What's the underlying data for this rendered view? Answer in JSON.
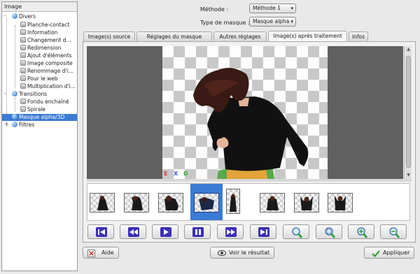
{
  "tree": {
    "header": "Image",
    "items": [
      {
        "label": "Divers",
        "kind": "node"
      },
      {
        "label": "Planche-contact",
        "kind": "leaf"
      },
      {
        "label": "Information",
        "kind": "leaf"
      },
      {
        "label": "Changement d...",
        "kind": "leaf"
      },
      {
        "label": "Redimension",
        "kind": "leaf"
      },
      {
        "label": "Ajout d'éléments",
        "kind": "leaf"
      },
      {
        "label": "Image composite",
        "kind": "leaf"
      },
      {
        "label": "Renommage d'i...",
        "kind": "leaf"
      },
      {
        "label": "Pour le web",
        "kind": "leaf"
      },
      {
        "label": "Multiplication d'i...",
        "kind": "leaf"
      },
      {
        "label": "Transitions",
        "kind": "node"
      },
      {
        "label": "Fondu enchaîné",
        "kind": "leaf"
      },
      {
        "label": "Spirale",
        "kind": "leaf"
      },
      {
        "label": "Masque alpha/3D",
        "kind": "node",
        "selected": true
      },
      {
        "label": "Filtres",
        "kind": "node"
      }
    ]
  },
  "settings": {
    "method_label": "Méthode :",
    "method_value": "Méthode 1",
    "mask_label": "Type de masque :",
    "mask_value": "Masque alpha"
  },
  "tabs": [
    {
      "label": "Image(s) source"
    },
    {
      "label": "Réglages du masque"
    },
    {
      "label": "Autres réglages"
    },
    {
      "label": "Image(s) après traitement",
      "active": true
    },
    {
      "label": "Infos"
    }
  ],
  "preview": {
    "channel_letters": [
      "E",
      "X",
      "D"
    ],
    "channel_colors": [
      "#d23c3c",
      "#3c58d2",
      "#3cae3c"
    ]
  },
  "thumbnails": {
    "count": 8,
    "selected_index": 3
  },
  "playback": [
    {
      "icon": "first-frame-icon"
    },
    {
      "icon": "rewind-icon"
    },
    {
      "icon": "play-icon"
    },
    {
      "icon": "pause-icon"
    },
    {
      "icon": "fast-forward-icon"
    },
    {
      "icon": "last-frame-icon"
    },
    {
      "icon": "zoom-icon"
    },
    {
      "icon": "zoom-fit-icon"
    },
    {
      "icon": "zoom-in-icon"
    },
    {
      "icon": "zoom-out-icon"
    }
  ],
  "footer": {
    "help_label": "Aide",
    "view_label": "Voir le résultat",
    "apply_label": "Appliquer"
  },
  "colors": {
    "accent": "#3a7bd5",
    "button_icon": "#3b2fb8"
  }
}
